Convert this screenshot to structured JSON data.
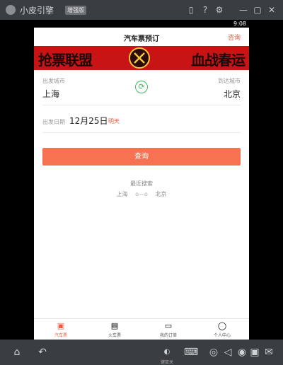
{
  "emulator": {
    "app_name": "小皮引擎",
    "edition_badge": "增强版",
    "titlebar_icons": [
      "phone-icon",
      "help-icon",
      "gear-icon",
      "minimize-icon",
      "maximize-icon",
      "close-icon"
    ],
    "bottom_icons": [
      "home-icon",
      "back-icon",
      "keymap-toggle-icon",
      "keyboard-icon",
      "gamepad-icon",
      "volume-icon",
      "record-icon",
      "clipboard-icon",
      "gift-icon"
    ],
    "keymap_label": "键鼠关"
  },
  "status_bar": {
    "time": "9:08"
  },
  "header": {
    "title": "汽车票预订",
    "consult": "咨询"
  },
  "banner": {
    "left_text": "抢票联盟",
    "right_text": "血战春运"
  },
  "form": {
    "from_label": "出发城市",
    "from_city": "上海",
    "to_label": "到达城市",
    "to_city": "北京",
    "date_label": "出发日期",
    "date_value": "12月25日",
    "date_hint": "明天",
    "search_button": "查询"
  },
  "recent": {
    "title": "最近搜索",
    "from": "上海",
    "to": "北京"
  },
  "tabs": [
    {
      "label": "汽车票",
      "icon": "bus-icon",
      "active": true
    },
    {
      "label": "火车票",
      "icon": "train-icon",
      "active": false
    },
    {
      "label": "我的订单",
      "icon": "order-icon",
      "active": false
    },
    {
      "label": "个人中心",
      "icon": "user-icon",
      "active": false
    }
  ],
  "colors": {
    "accent": "#f77251",
    "link": "#f0563a",
    "swap": "#3cba5c",
    "banner": "#c81414"
  }
}
